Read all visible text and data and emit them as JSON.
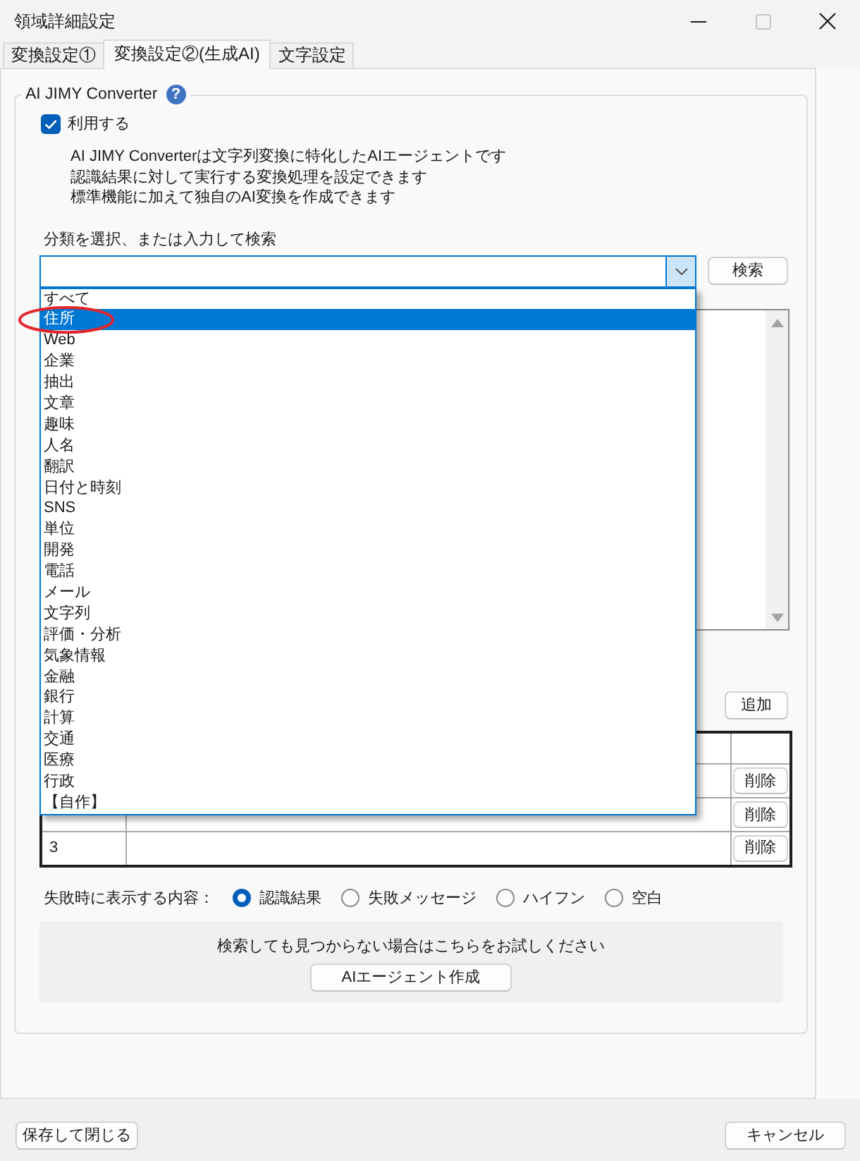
{
  "window": {
    "title": "領域詳細設定",
    "maximize_button": {
      "disabled": true
    }
  },
  "tabs": [
    {
      "label": "変換設定①",
      "selected": false
    },
    {
      "label": "変換設定②(生成AI)",
      "selected": true
    },
    {
      "label": "文字設定",
      "selected": false
    }
  ],
  "group": {
    "title": "AI JIMY Converter",
    "help_glyph": "?"
  },
  "use_checkbox": {
    "label": "利用する",
    "checked": true
  },
  "description_lines": [
    "AI JIMY Converterは文字列変換に特化したAIエージェントです",
    "認識結果に対して実行する変換処理を設定できます",
    "標準機能に加えて独自のAI変換を作成できます"
  ],
  "category_search": {
    "label": "分類を選択、または入力して検索",
    "button": "検索",
    "expanded": true,
    "items": [
      {
        "label": "すべて",
        "selected": false,
        "circled": false
      },
      {
        "label": "住所",
        "selected": true,
        "circled": true
      },
      {
        "label": "Web",
        "selected": false,
        "circled": false
      },
      {
        "label": "企業",
        "selected": false,
        "circled": false
      },
      {
        "label": "抽出",
        "selected": false,
        "circled": false
      },
      {
        "label": "文章",
        "selected": false,
        "circled": false
      },
      {
        "label": "趣味",
        "selected": false,
        "circled": false
      },
      {
        "label": "人名",
        "selected": false,
        "circled": false
      },
      {
        "label": "翻訳",
        "selected": false,
        "circled": false
      },
      {
        "label": "日付と時刻",
        "selected": false,
        "circled": false
      },
      {
        "label": "SNS",
        "selected": false,
        "circled": false
      },
      {
        "label": "単位",
        "selected": false,
        "circled": false
      },
      {
        "label": "開発",
        "selected": false,
        "circled": false
      },
      {
        "label": "電話",
        "selected": false,
        "circled": false
      },
      {
        "label": "メール",
        "selected": false,
        "circled": false
      },
      {
        "label": "文字列",
        "selected": false,
        "circled": false
      },
      {
        "label": "評価・分析",
        "selected": false,
        "circled": false
      },
      {
        "label": "気象情報",
        "selected": false,
        "circled": false
      },
      {
        "label": "金融",
        "selected": false,
        "circled": false
      },
      {
        "label": "銀行",
        "selected": false,
        "circled": false
      },
      {
        "label": "計算",
        "selected": false,
        "circled": false
      },
      {
        "label": "交通",
        "selected": false,
        "circled": false
      },
      {
        "label": "医療",
        "selected": false,
        "circled": false
      },
      {
        "label": "行政",
        "selected": false,
        "circled": false
      },
      {
        "label": "【自作】",
        "selected": false,
        "circled": false
      }
    ]
  },
  "add_button": "追加",
  "table": {
    "rows": [
      {
        "delete_button": "削除"
      },
      {
        "delete_button": "削除"
      },
      {
        "number": "3",
        "delete_button": "削除"
      }
    ]
  },
  "failure_display": {
    "label": "失敗時に表示する内容：",
    "options": [
      {
        "label": "認識結果",
        "selected": true
      },
      {
        "label": "失敗メッセージ",
        "selected": false
      },
      {
        "label": "ハイフン",
        "selected": false
      },
      {
        "label": "空白",
        "selected": false
      }
    ]
  },
  "help_panel": {
    "text": "検索しても見つからない場合はこちらをお試しください",
    "button": "AIエージェント作成"
  },
  "footer": {
    "save_button": "保存して閉じる",
    "cancel_button": "キャンセル"
  }
}
